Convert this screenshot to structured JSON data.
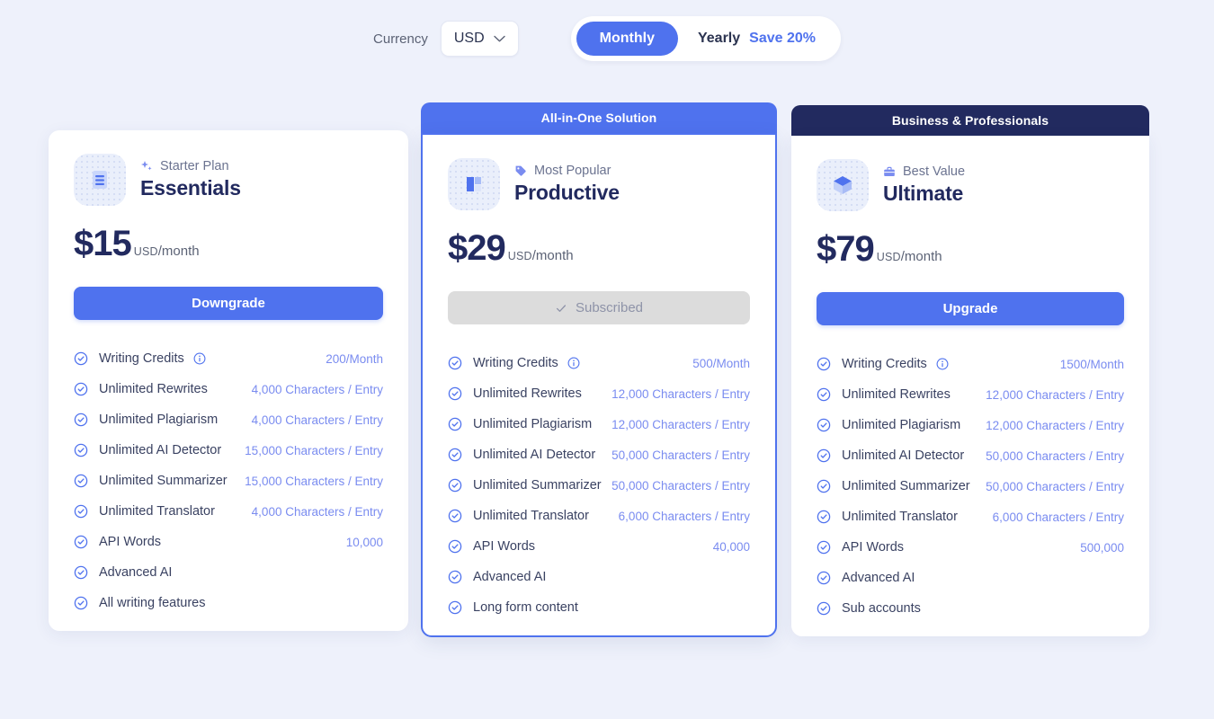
{
  "controls": {
    "currency_label": "Currency",
    "currency_value": "USD",
    "monthly_label": "Monthly",
    "yearly_label": "Yearly",
    "save_label": "Save 20%"
  },
  "colors": {
    "accent": "#4f72ee",
    "navy": "#222a5f",
    "value_text": "#7a8cf0",
    "page_bg": "#eef1fb"
  },
  "plans": [
    {
      "banner": "",
      "badge_icon": "sparkle-icon",
      "badge": "Starter Plan",
      "icon": "document-lines-icon",
      "name": "Essentials",
      "price": "$15",
      "currency": "USD",
      "period": "/month",
      "cta": "Downgrade",
      "cta_state": "active",
      "features": [
        {
          "label": "Writing Credits",
          "value": "200/Month",
          "info": true
        },
        {
          "label": "Unlimited Rewrites",
          "value": "4,000 Characters / Entry",
          "info": false
        },
        {
          "label": "Unlimited Plagiarism",
          "value": "4,000 Characters / Entry",
          "info": false
        },
        {
          "label": "Unlimited AI Detector",
          "value": "15,000 Characters / Entry",
          "info": false
        },
        {
          "label": "Unlimited Summarizer",
          "value": "15,000 Characters / Entry",
          "info": false
        },
        {
          "label": "Unlimited Translator",
          "value": "4,000 Characters / Entry",
          "info": false
        },
        {
          "label": "API Words",
          "value": "10,000",
          "info": false
        },
        {
          "label": "Advanced AI",
          "value": "",
          "info": false
        },
        {
          "label": "All writing features",
          "value": "",
          "info": false
        }
      ]
    },
    {
      "banner": "All-in-One Solution",
      "badge_icon": "tag-icon",
      "badge": "Most Popular",
      "icon": "layout-block-icon",
      "name": "Productive",
      "price": "$29",
      "currency": "USD",
      "period": "/month",
      "cta": "Subscribed",
      "cta_state": "disabled",
      "features": [
        {
          "label": "Writing Credits",
          "value": "500/Month",
          "info": true
        },
        {
          "label": "Unlimited Rewrites",
          "value": "12,000 Characters / Entry",
          "info": false
        },
        {
          "label": "Unlimited Plagiarism",
          "value": "12,000 Characters / Entry",
          "info": false
        },
        {
          "label": "Unlimited AI Detector",
          "value": "50,000 Characters / Entry",
          "info": false
        },
        {
          "label": "Unlimited Summarizer",
          "value": "50,000 Characters / Entry",
          "info": false
        },
        {
          "label": "Unlimited Translator",
          "value": "6,000 Characters / Entry",
          "info": false
        },
        {
          "label": "API Words",
          "value": "40,000",
          "info": false
        },
        {
          "label": "Advanced AI",
          "value": "",
          "info": false
        },
        {
          "label": "Long form content",
          "value": "",
          "info": false
        }
      ]
    },
    {
      "banner": "Business & Professionals",
      "badge_icon": "briefcase-icon",
      "badge": "Best Value",
      "icon": "cube-icon",
      "name": "Ultimate",
      "price": "$79",
      "currency": "USD",
      "period": "/month",
      "cta": "Upgrade",
      "cta_state": "active",
      "features": [
        {
          "label": "Writing Credits",
          "value": "1500/Month",
          "info": true
        },
        {
          "label": "Unlimited Rewrites",
          "value": "12,000 Characters / Entry",
          "info": false
        },
        {
          "label": "Unlimited Plagiarism",
          "value": "12,000 Characters / Entry",
          "info": false
        },
        {
          "label": "Unlimited AI Detector",
          "value": "50,000 Characters / Entry",
          "info": false
        },
        {
          "label": "Unlimited Summarizer",
          "value": "50,000 Characters / Entry",
          "info": false
        },
        {
          "label": "Unlimited Translator",
          "value": "6,000 Characters / Entry",
          "info": false
        },
        {
          "label": "API Words",
          "value": "500,000",
          "info": false
        },
        {
          "label": "Advanced AI",
          "value": "",
          "info": false
        },
        {
          "label": "Sub accounts",
          "value": "",
          "info": false
        }
      ]
    }
  ]
}
